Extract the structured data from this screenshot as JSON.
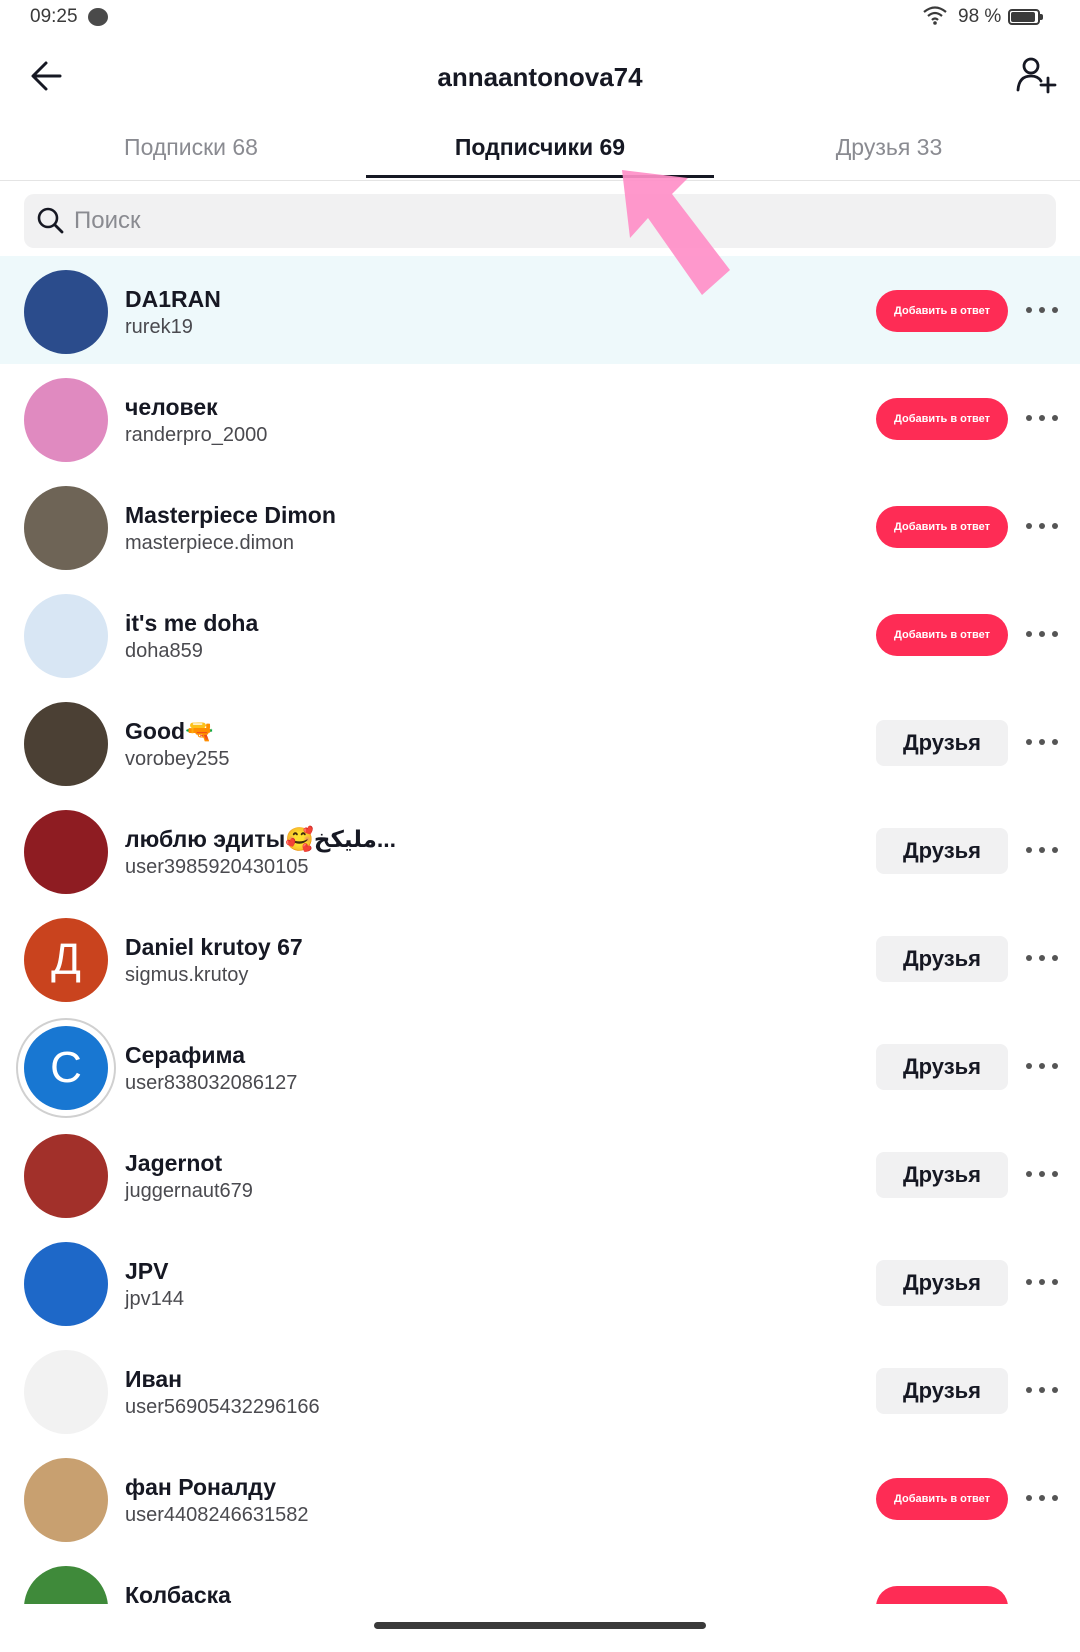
{
  "status_bar": {
    "time": "09:25",
    "battery": "98 %"
  },
  "header": {
    "title": "annaantonova74",
    "back_icon": "arrow-left-icon",
    "add_friend_icon": "user-plus-icon"
  },
  "tabs": [
    {
      "label": "Подписки 68"
    },
    {
      "label": "Подписчики 69"
    },
    {
      "label": "Друзья 33"
    }
  ],
  "search": {
    "placeholder": "Поиск",
    "value": ""
  },
  "colors": {
    "accent": "#fe2c55",
    "secondary_button": "#f1f1f2",
    "highlight_row": "#eef9fb",
    "annotation_arrow": "#ff8fc8"
  },
  "followers": [
    {
      "name": "DA1RAN",
      "username": "rurek19",
      "button": "Добавить в ответ",
      "type": "follow-back",
      "highlight": true,
      "avatar_color": "#2b4c8c"
    },
    {
      "name": "человек",
      "username": "randerpro_2000",
      "button": "Добавить в ответ",
      "type": "follow-back",
      "avatar_color": "#e08ac0"
    },
    {
      "name": "Masterpiece Dimon",
      "username": "masterpiece.dimon",
      "button": "Добавить в ответ",
      "type": "follow-back",
      "avatar_color": "#6e6456"
    },
    {
      "name": "it's me doha",
      "username": "doha859",
      "button": "Добавить в ответ",
      "type": "follow-back",
      "avatar_color": "#d8e6f4"
    },
    {
      "name": "Good🔫",
      "username": "vorobey255",
      "button": "Друзья",
      "type": "friends",
      "avatar_color": "#4b4034"
    },
    {
      "name": "люблю эдиты🥰مليكخ...",
      "username": "user3985920430105",
      "button": "Друзья",
      "type": "friends",
      "avatar_color": "#8e1c22"
    },
    {
      "name": "Daniel krutoy 67",
      "username": "sigmus.krutoy",
      "button": "Друзья",
      "type": "friends",
      "avatar_color": "#c9431e",
      "avatar_letter": "Д"
    },
    {
      "name": "Серафима",
      "username": "user838032086127",
      "button": "Друзья",
      "type": "friends",
      "avatar_color": "#1877d2",
      "avatar_letter": "С",
      "ringed": true
    },
    {
      "name": "Jagernot",
      "username": "juggernaut679",
      "button": "Друзья",
      "type": "friends",
      "avatar_color": "#a2302a"
    },
    {
      "name": "JPV",
      "username": "jpv144",
      "button": "Друзья",
      "type": "friends",
      "avatar_color": "#1e68c8"
    },
    {
      "name": "Иван",
      "username": "user56905432296166",
      "button": "Друзья",
      "type": "friends",
      "avatar_color": "#f2f2f2"
    },
    {
      "name": "фан Роналду",
      "username": "user4408246631582",
      "button": "Добавить в ответ",
      "type": "follow-back",
      "avatar_color": "#c8a070"
    },
    {
      "name": "Колбаска",
      "username": "",
      "button": "",
      "type": "follow-back",
      "avatar_color": "#3f8a3a"
    }
  ]
}
